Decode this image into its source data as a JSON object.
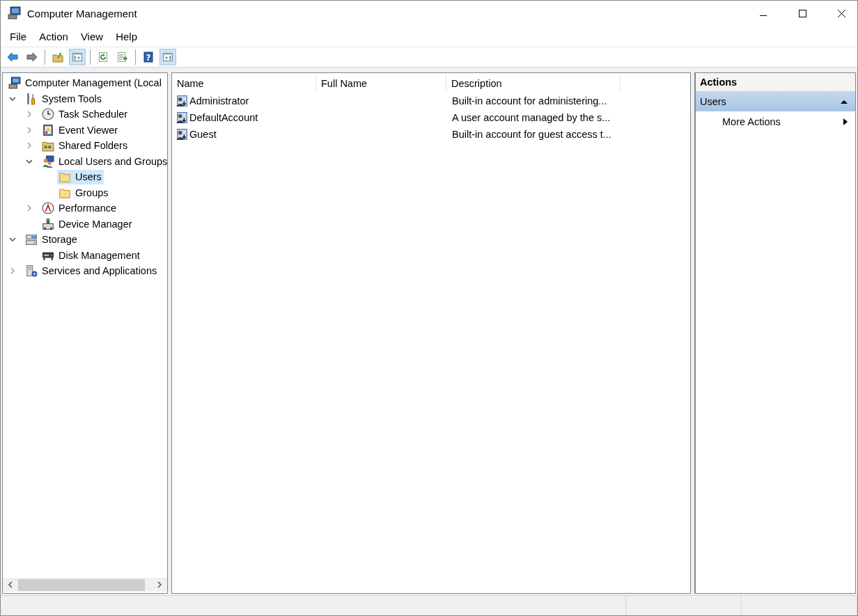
{
  "window": {
    "title": "Computer Management"
  },
  "menu": [
    "File",
    "Action",
    "View",
    "Help"
  ],
  "toolbar": [
    {
      "kind": "back",
      "pressed": false
    },
    {
      "kind": "forward",
      "pressed": false
    },
    {
      "kind": "separator"
    },
    {
      "kind": "up-folder",
      "pressed": false
    },
    {
      "kind": "console-tree",
      "pressed": true
    },
    {
      "kind": "separator"
    },
    {
      "kind": "refresh",
      "pressed": false
    },
    {
      "kind": "export",
      "pressed": false
    },
    {
      "kind": "separator"
    },
    {
      "kind": "help",
      "pressed": false,
      "glyph": "?"
    },
    {
      "kind": "action-pane",
      "pressed": true
    }
  ],
  "tree": [
    {
      "label": "Computer Management (Local",
      "kind": "computer",
      "selected": false,
      "children": [
        {
          "label": "System Tools",
          "kind": "tools",
          "expanded": true,
          "selected": false,
          "children": [
            {
              "label": "Task Scheduler",
              "kind": "clock",
              "expanded": false,
              "selected": false
            },
            {
              "label": "Event Viewer",
              "kind": "event-log",
              "expanded": false,
              "selected": false
            },
            {
              "label": "Shared Folders",
              "kind": "shared-folder",
              "expanded": false,
              "selected": false
            },
            {
              "label": "Local Users and Groups",
              "kind": "users",
              "expanded": true,
              "selected": false,
              "children": [
                {
                  "label": "Users",
                  "kind": "folder",
                  "selected": true
                },
                {
                  "label": "Groups",
                  "kind": "folder",
                  "selected": false
                }
              ]
            },
            {
              "label": "Performance",
              "kind": "gauge",
              "expanded": false,
              "selected": false
            },
            {
              "label": "Device Manager",
              "kind": "device",
              "selected": false
            }
          ]
        },
        {
          "label": "Storage",
          "kind": "storage",
          "expanded": true,
          "selected": false,
          "children": [
            {
              "label": "Disk Management",
              "kind": "disk",
              "selected": false
            }
          ]
        },
        {
          "label": "Services and Applications",
          "kind": "services",
          "expanded": false,
          "selected": false
        }
      ]
    }
  ],
  "table": {
    "columns": [
      "Name",
      "Full Name",
      "Description"
    ],
    "rows": [
      {
        "name": "Administrator",
        "description": "Built-in account for administering..."
      },
      {
        "name": "DefaultAccount",
        "description": "A user account managed by the s..."
      },
      {
        "name": "Guest",
        "description": "Built-in account for guest access t..."
      }
    ]
  },
  "actions": {
    "title": "Actions",
    "sections": [
      {
        "label": "Users",
        "expanded": true,
        "items": [
          {
            "label": "More Actions",
            "submenu": true
          }
        ]
      }
    ]
  }
}
